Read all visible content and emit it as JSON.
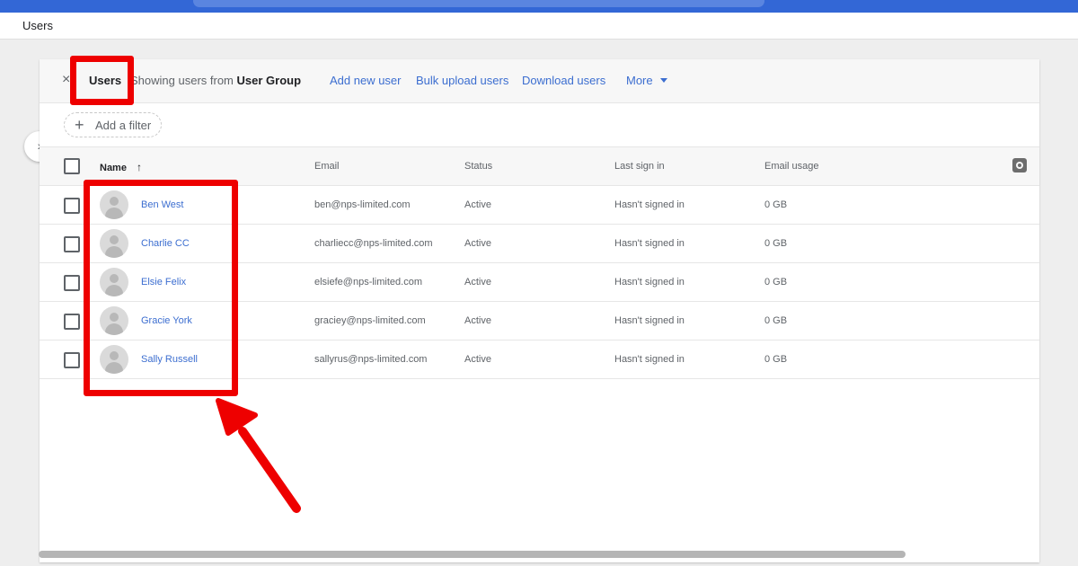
{
  "page": {
    "title": "Users"
  },
  "header": {
    "title": "Users",
    "subtitle_prefix": "Showing users from",
    "subtitle_group": "User Group",
    "actions": {
      "add_new_user": "Add new user",
      "bulk_upload": "Bulk upload users",
      "download": "Download users",
      "more": "More"
    }
  },
  "filter": {
    "label": "Add a filter"
  },
  "table": {
    "columns": {
      "name": "Name",
      "email": "Email",
      "status": "Status",
      "last_sign_in": "Last sign in",
      "email_usage": "Email usage"
    },
    "rows": [
      {
        "name": "Ben West",
        "email": "ben@nps-limited.com",
        "status": "Active",
        "last_sign_in": "Hasn't signed in",
        "email_usage": "0 GB"
      },
      {
        "name": "Charlie CC",
        "email": "charliecc@nps-limited.com",
        "status": "Active",
        "last_sign_in": "Hasn't signed in",
        "email_usage": "0 GB"
      },
      {
        "name": "Elsie Felix",
        "email": "elsiefe@nps-limited.com",
        "status": "Active",
        "last_sign_in": "Hasn't signed in",
        "email_usage": "0 GB"
      },
      {
        "name": "Gracie York",
        "email": "graciey@nps-limited.com",
        "status": "Active",
        "last_sign_in": "Hasn't signed in",
        "email_usage": "0 GB"
      },
      {
        "name": "Sally Russell",
        "email": "sallyrus@nps-limited.com",
        "status": "Active",
        "last_sign_in": "Hasn't signed in",
        "email_usage": "0 GB"
      }
    ]
  },
  "icons": {
    "close": "close-icon",
    "sort": "arrow-up-icon",
    "settings": "gear-icon",
    "expand": "chevron-right-icon",
    "add": "plus-icon",
    "caret": "caret-down-icon"
  },
  "colors": {
    "brand_bar": "#3367d6",
    "link": "#3c6ed0",
    "highlight": "#ee0000"
  }
}
